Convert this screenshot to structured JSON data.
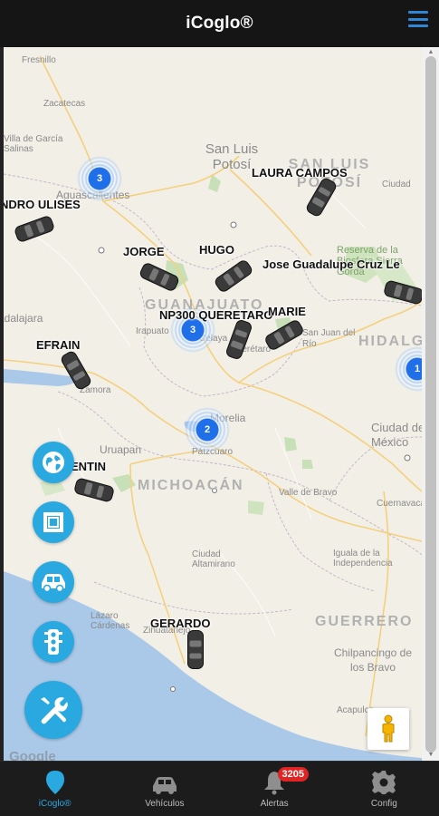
{
  "header": {
    "title": "iCoglo®"
  },
  "map": {
    "places": [
      {
        "name": "Fresnillo",
        "cls": "small"
      },
      {
        "name": "Zacatecas",
        "cls": "small"
      },
      {
        "name": "Villa de García Salinas",
        "cls": "small"
      },
      {
        "name": "Aguascalientes",
        "cls": ""
      },
      {
        "name": "San Luis Potosí",
        "cls": ""
      },
      {
        "name": "SAN LUIS POTOSÍ",
        "cls": "region"
      },
      {
        "name": "Ciudad",
        "cls": "small"
      },
      {
        "name": "Reserva de la Biosfera Sierra Gorda",
        "cls": "green"
      },
      {
        "name": "GUANAJUATO",
        "cls": "region"
      },
      {
        "name": "Irapuato",
        "cls": ""
      },
      {
        "name": "Celaya",
        "cls": ""
      },
      {
        "name": "Querétaro",
        "cls": ""
      },
      {
        "name": "San Juan del Río",
        "cls": "small"
      },
      {
        "name": "HIDALGO",
        "cls": "region"
      },
      {
        "name": "Guadalajara",
        "cls": ""
      },
      {
        "name": "Zamora",
        "cls": "small"
      },
      {
        "name": "Morelia",
        "cls": ""
      },
      {
        "name": "Pátzcuaro",
        "cls": "small"
      },
      {
        "name": "Uruapan",
        "cls": ""
      },
      {
        "name": "MICHOACÁN",
        "cls": "region"
      },
      {
        "name": "Ciudad de México",
        "cls": ""
      },
      {
        "name": "Valle de Bravo",
        "cls": "small"
      },
      {
        "name": "Cuernavaca",
        "cls": "small"
      },
      {
        "name": "Ciudad Altamirano",
        "cls": "small"
      },
      {
        "name": "Iguala de la Independencia",
        "cls": "small"
      },
      {
        "name": "Lázaro Cárdenas",
        "cls": "small"
      },
      {
        "name": "Zihuatanejo",
        "cls": "small"
      },
      {
        "name": "GUERRERO",
        "cls": "region"
      },
      {
        "name": "Chilpancingo de los Bravo",
        "cls": ""
      },
      {
        "name": "Acapulco",
        "cls": "small"
      }
    ],
    "vehicles": [
      {
        "label": "LAURA CAMPOS"
      },
      {
        "label": "NDRO ULISES"
      },
      {
        "label": "JORGE"
      },
      {
        "label": "HUGO"
      },
      {
        "label": "Jose Guadalupe Cruz Le"
      },
      {
        "label": "NP300 QUERETARO"
      },
      {
        "label": "MARIE"
      },
      {
        "label": "EFRAIN"
      },
      {
        "label": "ENTIN"
      },
      {
        "label": "GERARDO"
      }
    ],
    "clusters": [
      {
        "count": "3"
      },
      {
        "count": "3"
      },
      {
        "count": "2"
      },
      {
        "count": "1"
      }
    ],
    "logo": "Google"
  },
  "fabs": [
    {
      "name": "globe",
      "icon": "globe-icon"
    },
    {
      "name": "area",
      "icon": "frame-icon"
    },
    {
      "name": "vehicles",
      "icon": "car-icon"
    },
    {
      "name": "traffic",
      "icon": "traffic-light-icon"
    },
    {
      "name": "tools",
      "icon": "tools-icon"
    }
  ],
  "nav": {
    "items": [
      {
        "label": "iCoglo®",
        "icon": "map-pin-icon"
      },
      {
        "label": "Vehículos",
        "icon": "car-icon"
      },
      {
        "label": "Alertas",
        "icon": "bell-icon"
      },
      {
        "label": "Config",
        "icon": "gear-icon"
      }
    ],
    "alert_badge": "3205"
  },
  "colors": {
    "accent": "#2aa9e0",
    "header_bg": "#151515",
    "cluster": "#1f6fe8",
    "badge": "#e02424"
  }
}
